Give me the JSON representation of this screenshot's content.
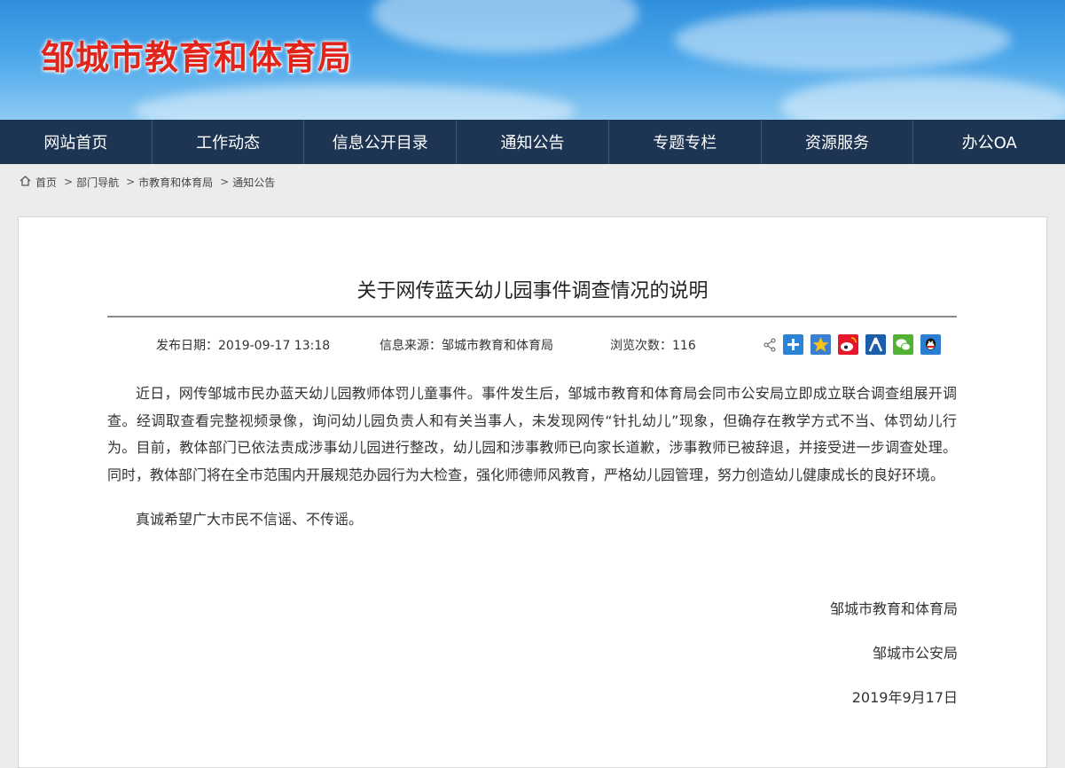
{
  "site": {
    "title": "邹城市教育和体育局"
  },
  "nav": {
    "items": [
      {
        "label": "网站首页"
      },
      {
        "label": "工作动态"
      },
      {
        "label": "信息公开目录"
      },
      {
        "label": "通知公告"
      },
      {
        "label": "专题专栏"
      },
      {
        "label": "资源服务"
      },
      {
        "label": "办公OA"
      }
    ]
  },
  "breadcrumb": {
    "home": "首页",
    "items": [
      "部门导航",
      "市教育和体育局",
      "通知公告"
    ],
    "separator": ">"
  },
  "article": {
    "title": "关于网传蓝天幼儿园事件调查情况的说明",
    "date": "发布日期：2019-09-17 13:18",
    "source": "信息来源：邹城市教育和体育局",
    "views": "浏览次数：116",
    "paragraphs": [
      "近日，网传邹城市民办蓝天幼儿园教师体罚儿童事件。事件发生后，邹城市教育和体育局会同市公安局立即成立联合调查组展开调查。经调取查看完整视频录像，询问幼儿园负责人和有关当事人，未发现网传“针扎幼儿”现象，但确存在教学方式不当、体罚幼儿行为。目前，教体部门已依法责成涉事幼儿园进行整改，幼儿园和涉事教师已向家长道歉，涉事教师已被辞退，并接受进一步调查处理。同时，教体部门将在全市范围内开展规范办园行为大检查，强化师德师风教育，严格幼儿园管理，努力创造幼儿健康成长的良好环境。",
      "真诚希望广大市民不信谣、不传谣。"
    ],
    "signatures": [
      "邹城市教育和体育局",
      "邹城市公安局",
      "2019年9月17日"
    ]
  },
  "share_icons": [
    "share-icon",
    "plus-share-icon",
    "qzone-icon",
    "weibo-icon",
    "renren-icon",
    "wechat-icon",
    "qq-icon"
  ],
  "colors": {
    "title_red": "#e1251b",
    "nav_bg": "#1d3553"
  }
}
